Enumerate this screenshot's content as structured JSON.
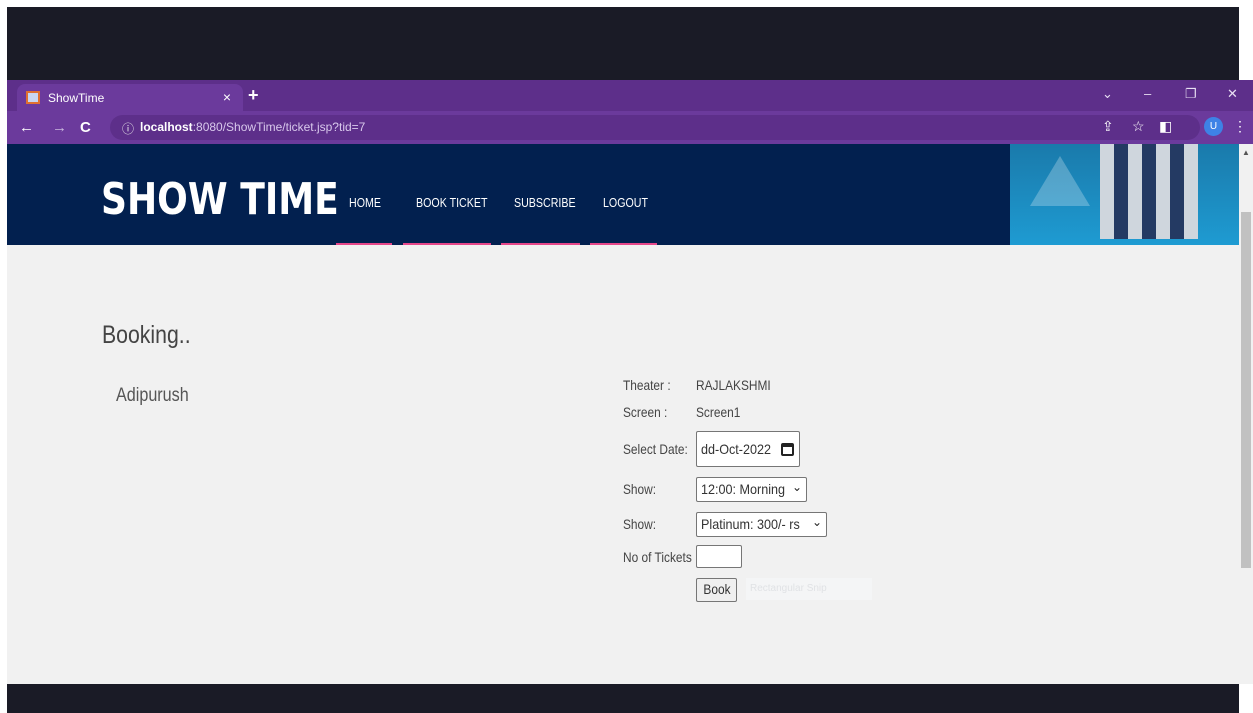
{
  "browser": {
    "tab_title": "ShowTime",
    "tab_close": "×",
    "new_tab": "+",
    "url_host": "localhost",
    "url_rest": ":8080/ShowTime/ticket.jsp?tid=7",
    "info_icon": "ⓘ",
    "avatar_letter": "U",
    "icons": {
      "back": "←",
      "forward": "→",
      "reload": "C",
      "share": "⇪",
      "star": "☆",
      "side_panel": "◧",
      "menu": "⋮",
      "tab_search": "⌄",
      "minimize": "–",
      "restore": "❐",
      "close": "✕"
    }
  },
  "site": {
    "logo": "SHOW TIME",
    "nav": [
      "HOME",
      "BOOK TICKET",
      "SUBSCRIBE",
      "LOGOUT"
    ],
    "accent_color": "#e6478a",
    "header_color": "#02204f"
  },
  "booking": {
    "heading": "Booking..",
    "movie": "Adipurush",
    "theater_label": "Theater :",
    "theater_value": "RAJLAKSHMI",
    "screen_label": "Screen :",
    "screen_value": "Screen1",
    "date_label": "Select Date:",
    "date_value": "dd-Oct-2022",
    "show_label": "Show:",
    "show_value": "12:00: Morning",
    "class_label": "Show:",
    "class_value": "Platinum:   300/- rs",
    "tickets_label": "No of Tickets :",
    "tickets_value": "",
    "book_button": "Book",
    "ghost_text": "Rectangular Snip"
  }
}
